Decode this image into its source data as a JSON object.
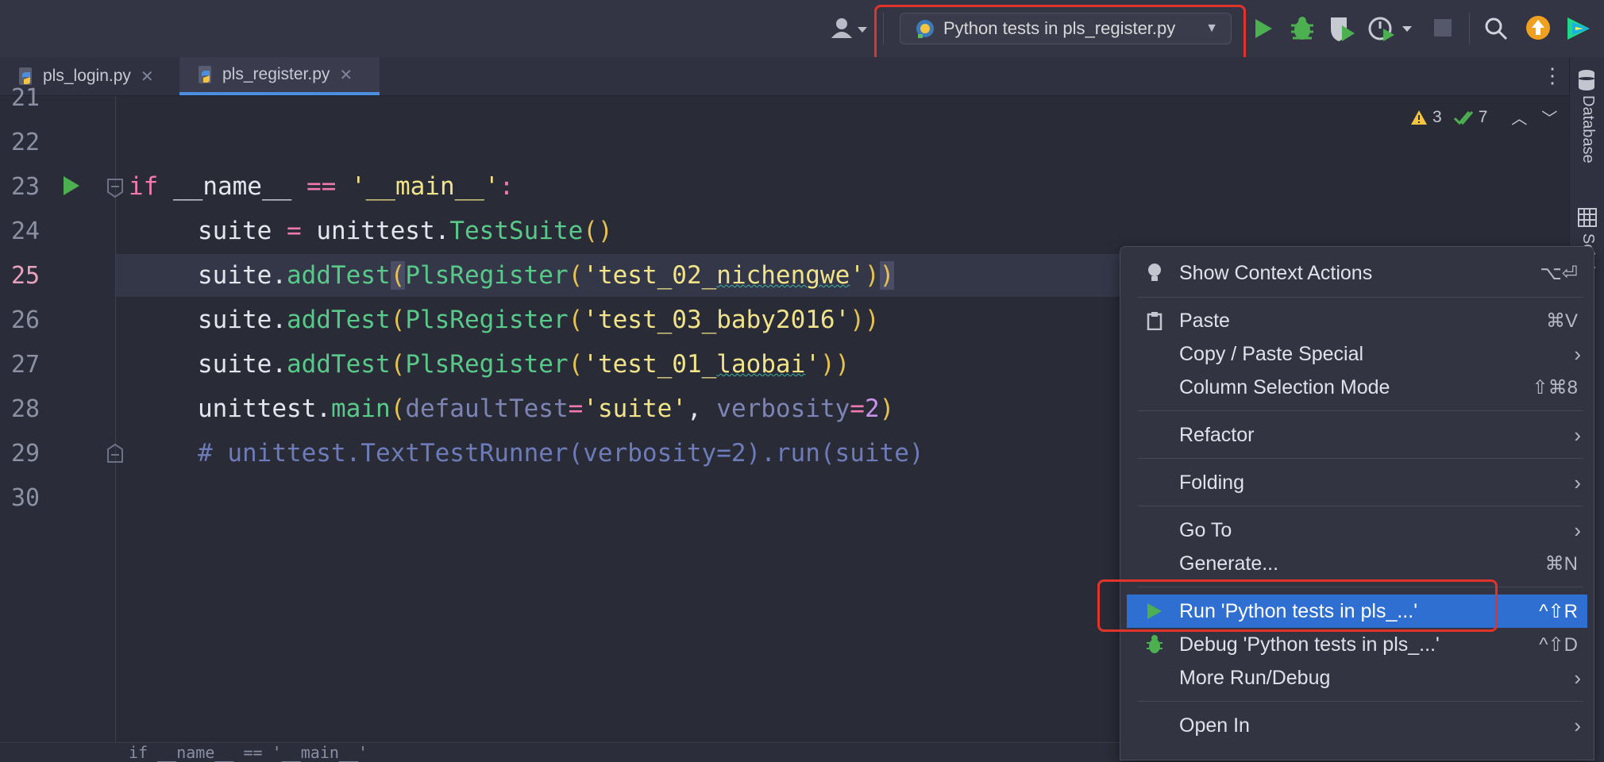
{
  "toolbar": {
    "run_config_label": "Python tests in pls_register.py",
    "colors": {
      "run_green": "#4caf50",
      "highlight_red": "#e0342b",
      "update_orange": "#f0a020"
    }
  },
  "tabs": [
    {
      "label": "pls_login.py",
      "active": false
    },
    {
      "label": "pls_register.py",
      "active": true
    }
  ],
  "inspections": {
    "warnings": "3",
    "ok": "7"
  },
  "editor": {
    "line_numbers": [
      "21",
      "22",
      "23",
      "24",
      "25",
      "26",
      "27",
      "28",
      "29",
      "30"
    ],
    "current_line": "25",
    "code": {
      "l23_kw": "if",
      "l23_a": " __name__ ",
      "l23_op": "==",
      "l23_sp": " ",
      "l23_str": "'__main__'",
      "l23_colon": ":",
      "l24_a": "suite ",
      "l24_op": "=",
      "l24_b": " unittest.",
      "l24_fn": "TestSuite",
      "l24_par": "()",
      "l25_a": "suite.",
      "l25_fn": "addTest",
      "l25_p1": "(",
      "l25_cls": "PlsRegister",
      "l25_p2": "(",
      "l25_s1": "'test_02_",
      "l25_s2": "nichengwe",
      "l25_s3": "'",
      "l25_p3": ")",
      "l25_p4": ")",
      "l26_a": "suite.",
      "l26_fn": "addTest",
      "l26_p1": "(",
      "l26_cls": "PlsRegister",
      "l26_p2": "(",
      "l26_str": "'test_03_baby2016'",
      "l26_p3": "))",
      "l27_a": "suite.",
      "l27_fn": "addTest",
      "l27_p1": "(",
      "l27_cls": "PlsRegister",
      "l27_p2": "(",
      "l27_s1": "'test_01_",
      "l27_s2": "laobai",
      "l27_s3": "'",
      "l27_p3": "))",
      "l28_a": "unittest.",
      "l28_fn": "main",
      "l28_p1": "(",
      "l28_k1": "defaultTest",
      "l28_eq1": "=",
      "l28_str": "'suite'",
      "l28_comma": ", ",
      "l28_k2": "verbosity",
      "l28_eq2": "=",
      "l28_num": "2",
      "l28_p2": ")",
      "l29_cmt": "# unittest.TextTestRunner(verbosity=2).run(suite)"
    },
    "breadcrumb": "if __name__ == '__main__'"
  },
  "right_sidebar": {
    "database_label": "Database",
    "scm_label": "SciView"
  },
  "context_menu": {
    "items": [
      {
        "label": "Show Context Actions",
        "shortcut": "⌥⏎",
        "icon": "lightbulb-icon"
      },
      {
        "label": "Paste",
        "shortcut": "⌘V",
        "icon": "clipboard-icon"
      },
      {
        "label": "Copy / Paste Special",
        "submenu": true
      },
      {
        "label": "Column Selection Mode",
        "shortcut": "⇧⌘8"
      },
      {
        "label": "Refactor",
        "submenu": true
      },
      {
        "label": "Folding",
        "submenu": true
      },
      {
        "label": "Go To",
        "submenu": true
      },
      {
        "label": "Generate...",
        "shortcut": "⌘N"
      },
      {
        "label": "Run 'Python tests in pls_...'",
        "shortcut": "^⇧R",
        "icon": "run-icon",
        "selected": true
      },
      {
        "label": "Debug 'Python tests in pls_...'",
        "shortcut": "^⇧D",
        "icon": "debug-bug-icon"
      },
      {
        "label": "More Run/Debug",
        "submenu": true
      },
      {
        "label": "Open In",
        "submenu": true
      }
    ]
  }
}
